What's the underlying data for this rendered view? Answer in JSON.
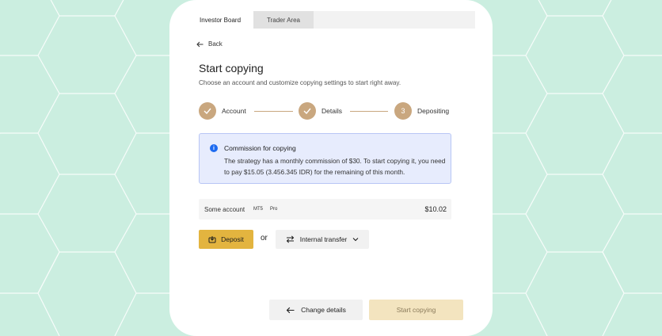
{
  "colors": {
    "background": "#cbeee0",
    "accent": "#c9a77f",
    "deposit": "#e3b43f",
    "info_bg": "#e7ecfd",
    "info_icon": "#1e6bf0"
  },
  "tabs": [
    {
      "label": "Investor Board",
      "active": true
    },
    {
      "label": "Trader Area",
      "active": false
    }
  ],
  "back_label": "Back",
  "title": "Start copying",
  "subtitle": "Choose an account and customize copying settings to start right away.",
  "steps": [
    {
      "label": "Account",
      "state": "done",
      "icon": "check-icon"
    },
    {
      "label": "Details",
      "state": "done",
      "icon": "check-icon"
    },
    {
      "label": "Depositing",
      "state": "current",
      "number": "3"
    }
  ],
  "info": {
    "icon": "info-icon",
    "title": "Commission for copying",
    "body": "The strategy has a monthly commission of $30. To start copying it, you need to pay $15.05 (3.456.345 IDR) for the remaining of this month."
  },
  "account": {
    "name": "Some account",
    "platform": "MT5",
    "type": "Pro",
    "balance": "$10.02"
  },
  "actions": {
    "deposit_label": "Deposit",
    "or_label": "or",
    "transfer_label": "Internal transfer",
    "change_details_label": "Change details",
    "start_copying_label": "Start copying"
  }
}
